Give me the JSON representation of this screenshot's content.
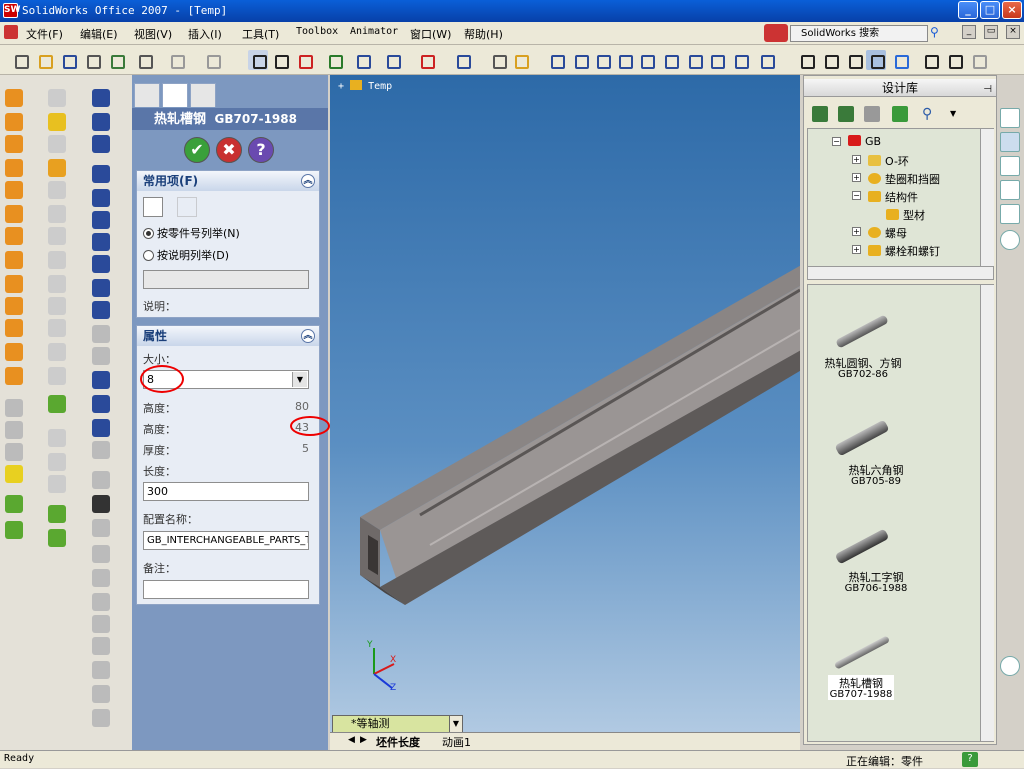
{
  "window": {
    "title": "SolidWorks Office 2007 - [Temp]",
    "app_icon": "SW",
    "min": "_",
    "max": "□",
    "close": "×",
    "doc_min": "_",
    "doc_max": "▭",
    "doc_close": "×"
  },
  "menu": {
    "items": [
      "文件(F)",
      "编辑(E)",
      "视图(V)",
      "插入(I)",
      "工具(T)",
      "Toolbox",
      "Animator",
      "窗口(W)",
      "帮助(H)"
    ],
    "search": "SolidWorks 搜索"
  },
  "property_manager": {
    "title": "热轧槽钢",
    "title_code": "GB707-1988",
    "ok": "✔",
    "cancel": "✖",
    "help": "?",
    "common": {
      "header": "常用项(F)",
      "radio1": "按零件号列举(N)",
      "radio2": "按说明列举(D)",
      "desc_label": "说明：",
      "desc_value": ""
    },
    "props": {
      "header": "属性",
      "size_label": "大小：",
      "size_value": "8",
      "height1_label": "高度：",
      "height1_value": "80",
      "height2_label": "高度：",
      "height2_value": "43",
      "thick_label": "厚度：",
      "thick_value": "5",
      "length_label": "长度：",
      "length_value": "300",
      "config_label": "配置名称：",
      "config_value": "GB_INTERCHANGEABLE_PARTS_T",
      "notes_label": "备注：",
      "notes_value": ""
    }
  },
  "viewport": {
    "tree_label": "Temp",
    "view_name": "*等轴测",
    "tabs": [
      "坯件长度",
      "动画1"
    ],
    "axes": {
      "x": "X",
      "y": "Y",
      "z": "Z"
    }
  },
  "design_library": {
    "title": "设计库",
    "tree": [
      {
        "label": "GB",
        "level": 0
      },
      {
        "label": "O-环",
        "level": 1
      },
      {
        "label": "垫圈和挡圈",
        "level": 1
      },
      {
        "label": "结构件",
        "level": 1
      },
      {
        "label": "型材",
        "level": 2
      },
      {
        "label": "螺母",
        "level": 1
      },
      {
        "label": "螺栓和螺钉",
        "level": 1
      }
    ],
    "items": [
      {
        "name": "热轧圆钢、方钢",
        "code": "GB702-86"
      },
      {
        "name": "热轧六角钢",
        "code": "GB705-89"
      },
      {
        "name": "热轧工字钢",
        "code": "GB706-1988"
      },
      {
        "name": "热轧槽钢",
        "code": "GB707-1988"
      }
    ]
  },
  "status": {
    "left": "Ready",
    "editing": "正在编辑：零件",
    "help": "?"
  }
}
